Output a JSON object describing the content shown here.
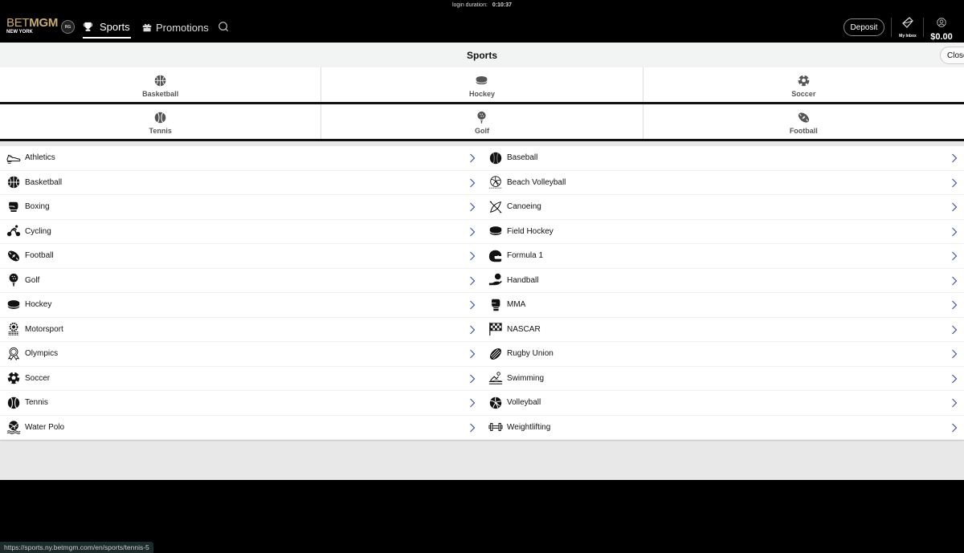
{
  "topbar": {
    "login_duration_label": "login duration:",
    "login_duration_value": "0:10:37",
    "logo": {
      "bet": "BET",
      "mgm": "MGM",
      "state": "NEW YORK"
    },
    "rg_badge": "RG",
    "nav": [
      {
        "label": "Sports",
        "icon": "trophy-icon",
        "active": true
      },
      {
        "label": "Promotions",
        "icon": "gift-icon",
        "active": false
      }
    ],
    "deposit_label": "Deposit",
    "inbox_label": "My Inbox",
    "balance": "$0.00"
  },
  "panel": {
    "title": "Sports",
    "close_label": "Close",
    "quick_links": [
      [
        {
          "label": "Basketball",
          "icon": "basketball-icon"
        },
        {
          "label": "Hockey",
          "icon": "hockey-puck-icon"
        },
        {
          "label": "Soccer",
          "icon": "soccer-ball-icon"
        }
      ],
      [
        {
          "label": "Tennis",
          "icon": "tennis-ball-icon"
        },
        {
          "label": "Golf",
          "icon": "golf-ball-icon"
        },
        {
          "label": "Football",
          "icon": "football-icon"
        }
      ]
    ],
    "sports_left": [
      {
        "label": "Athletics",
        "icon": "running-shoe-icon"
      },
      {
        "label": "Basketball",
        "icon": "basketball-icon"
      },
      {
        "label": "Boxing",
        "icon": "boxing-glove-icon"
      },
      {
        "label": "Cycling",
        "icon": "cyclist-icon"
      },
      {
        "label": "Football",
        "icon": "football-icon"
      },
      {
        "label": "Golf",
        "icon": "golf-ball-icon"
      },
      {
        "label": "Hockey",
        "icon": "hockey-puck-icon"
      },
      {
        "label": "Motorsport",
        "icon": "motorsport-icon"
      },
      {
        "label": "Olympics",
        "icon": "medal-icon"
      },
      {
        "label": "Soccer",
        "icon": "soccer-ball-icon"
      },
      {
        "label": "Tennis",
        "icon": "tennis-ball-icon"
      },
      {
        "label": "Water Polo",
        "icon": "water-polo-icon"
      }
    ],
    "sports_right": [
      {
        "label": "Baseball",
        "icon": "baseball-icon"
      },
      {
        "label": "Beach Volleyball",
        "icon": "beach-volleyball-icon"
      },
      {
        "label": "Canoeing",
        "icon": "canoe-icon"
      },
      {
        "label": "Field Hockey",
        "icon": "hockey-puck-icon"
      },
      {
        "label": "Formula 1",
        "icon": "helmet-icon"
      },
      {
        "label": "Handball",
        "icon": "handball-icon"
      },
      {
        "label": "MMA",
        "icon": "mma-glove-icon"
      },
      {
        "label": "NASCAR",
        "icon": "checkered-flag-icon"
      },
      {
        "label": "Rugby Union",
        "icon": "rugby-ball-icon"
      },
      {
        "label": "Swimming",
        "icon": "swimmer-icon"
      },
      {
        "label": "Volleyball",
        "icon": "volleyball-icon"
      },
      {
        "label": "Weightlifting",
        "icon": "barbell-icon"
      }
    ]
  },
  "status_bar": {
    "url": "https://sports.ny.betmgm.com/en/sports/tennis-5"
  },
  "colors": {
    "brand_gold": "#c9ad6a",
    "chevron_blue": "#3b4fc4"
  }
}
